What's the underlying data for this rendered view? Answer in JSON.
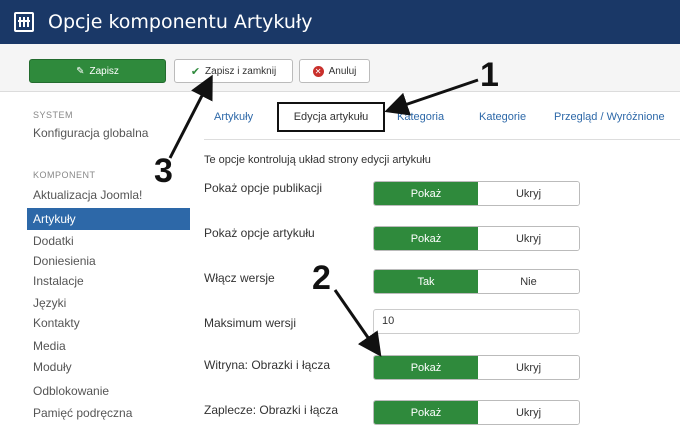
{
  "header": {
    "title": "Opcje komponentu Artykuły"
  },
  "toolbar": {
    "save": "Zapisz",
    "save_close": "Zapisz i zamknij",
    "cancel": "Anuluj"
  },
  "sidebar": {
    "system_heading": "SYSTEM",
    "global_config": "Konfiguracja globalna",
    "component_heading": "KOMPONENT",
    "items": [
      "Aktualizacja Joomla!",
      "Artykuły",
      "Dodatki",
      "Doniesienia",
      "Instalacje",
      "Języki",
      "Kontakty",
      "Media",
      "Moduły",
      "Odblokowanie",
      "Pamięć podręczna"
    ],
    "active": "Artykuły"
  },
  "tabs": [
    "Artykuły",
    "Edycja artykułu",
    "Kategoria",
    "Kategorie",
    "Przegląd / Wyróżnione"
  ],
  "active_tab": "Edycja artykułu",
  "intro": "Te opcje kontrolują układ strony edycji artykułu",
  "options": [
    {
      "label": "Pokaż opcje publikacji",
      "on": "Pokaż",
      "off": "Ukryj"
    },
    {
      "label": "Pokaż opcje artykułu",
      "on": "Pokaż",
      "off": "Ukryj"
    },
    {
      "label": "Włącz wersje",
      "on": "Tak",
      "off": "Nie"
    },
    {
      "label": "Maksimum wersji",
      "value": "10"
    },
    {
      "label": "Witryna: Obrazki i łącza",
      "on": "Pokaż",
      "off": "Ukryj"
    },
    {
      "label": "Zaplecze: Obrazki i łącza",
      "on": "Pokaż",
      "off": "Ukryj"
    }
  ],
  "annotations": [
    "1",
    "2",
    "3"
  ],
  "colors": {
    "header": "#1a3867",
    "save_green": "#2f8a3c",
    "active_blue": "#2d68a8",
    "cancel_red": "#c9302c"
  }
}
